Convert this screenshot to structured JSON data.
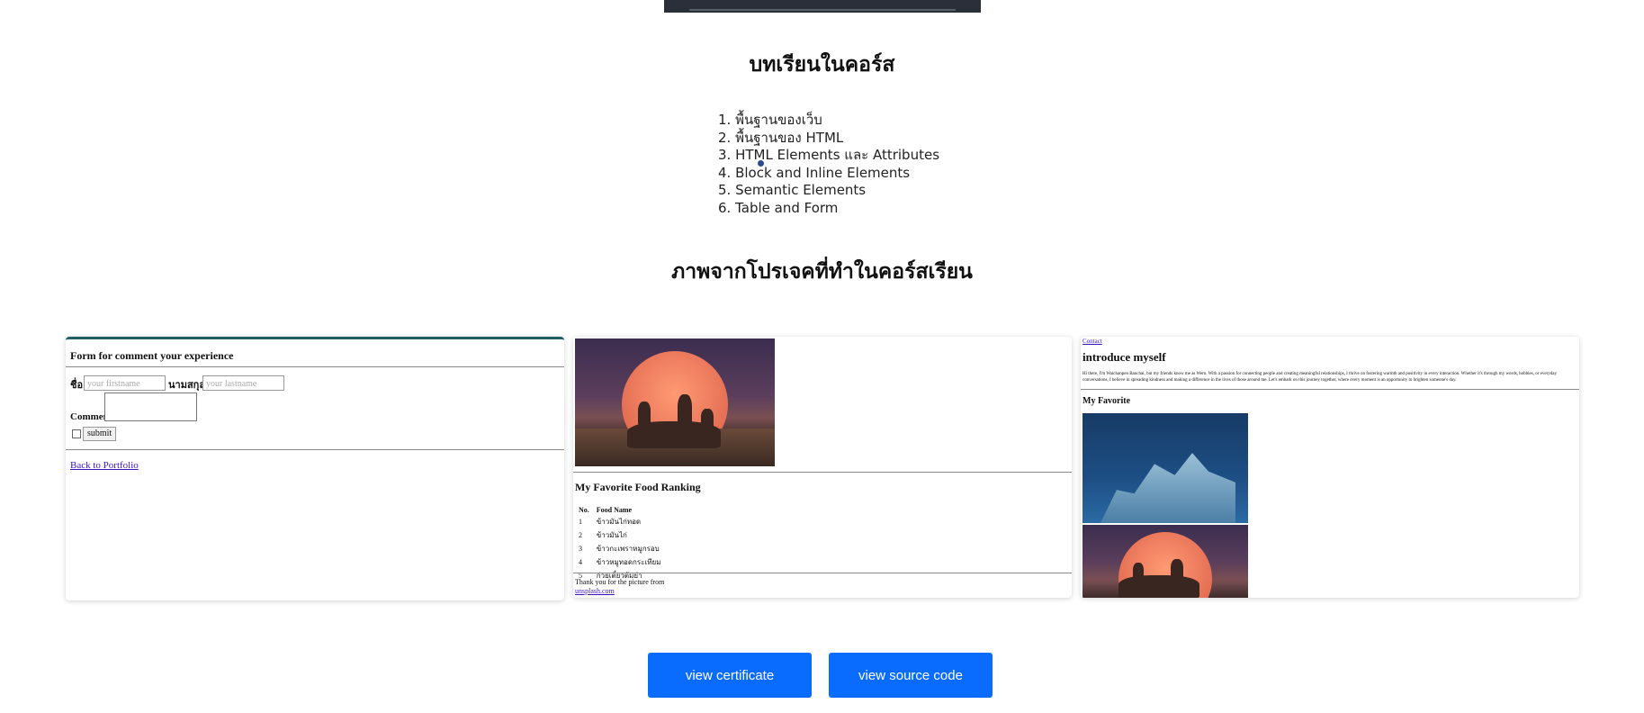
{
  "lessons": {
    "title": "บทเรียนในคอร์ส",
    "items": [
      "1. พื้นฐานของเว็บ",
      "2. พื้นฐานของ HTML",
      "3. HTML Elements และ Attributes",
      "4. Block and Inline Elements",
      "5. Semantic Elements",
      "6. Table and Form"
    ]
  },
  "projects": {
    "title": "ภาพจากโปรเจคที่ทำในคอร์สเรียน",
    "form_card": {
      "title": "Form for comment your experience",
      "firstname_label": "ชื่อ",
      "firstname_placeholder": "your firstname",
      "lastname_label": "นามสกุล",
      "lastname_placeholder": "your lastname",
      "comment_label": "Comment",
      "submit_label": "submit",
      "back_link": "Back to Portfolio"
    },
    "food_card": {
      "title": "My Favorite Food Ranking",
      "headers": [
        "No.",
        "Food Name"
      ],
      "rows": [
        [
          "1",
          "ข้าวมันไก่ทอด"
        ],
        [
          "2",
          "ข้าวมันไก่"
        ],
        [
          "3",
          "ข้าวกะเพราหมูกรอบ"
        ],
        [
          "4",
          "ข้าวหมูทอดกระเทียม"
        ],
        [
          "5",
          "ก๋วยเตี๋ยวต้มยำ"
        ]
      ],
      "thanks": "Thank you for the picture from",
      "credit": "unsplash.com"
    },
    "about_card": {
      "top_link": "Contact",
      "title": "introduce myself",
      "text": "Hi there, I'm Waichanpen Banchai, but my friends know me as Wern. With a passion for connecting people and creating meaningful relationships, I thrive on fostering warmth and positivity in every interaction. Whether it's through my words, hobbies, or everyday conversations, I believe in spreading kindness and making a difference in the lives of those around me. Let's embark on this journey together, where every moment is an opportunity to brighten someone's day.",
      "subtitle": "My Favorite"
    }
  },
  "buttons": {
    "certificate": "view certificate",
    "source": "view source code"
  },
  "colors": {
    "button_bg": "#0a6cff",
    "button_text": "#ffffff",
    "link": "#3a14c4"
  }
}
